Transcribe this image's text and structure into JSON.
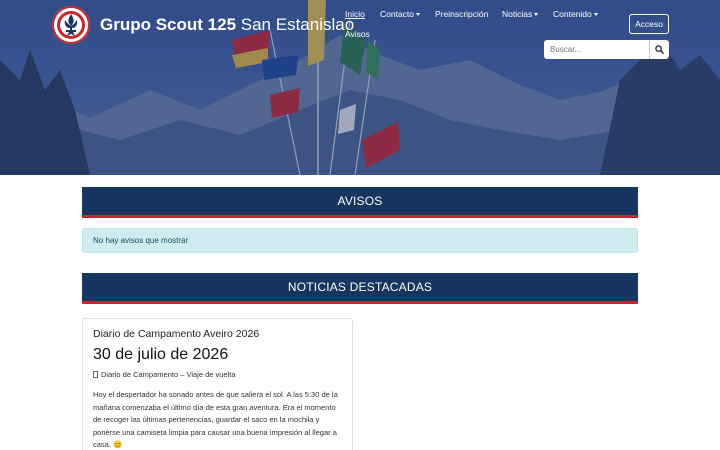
{
  "brand": {
    "bold": "Grupo Scout 125",
    "regular": " San Estanislao"
  },
  "nav": [
    {
      "label": "Inicio",
      "dropdown": false,
      "active": true
    },
    {
      "label": "Contacto",
      "dropdown": true,
      "active": false
    },
    {
      "label": "Preinscripción",
      "dropdown": false,
      "active": false
    },
    {
      "label": "Noticias",
      "dropdown": true,
      "active": false
    },
    {
      "label": "Contenido",
      "dropdown": true,
      "active": false
    },
    {
      "label": "Avisos",
      "dropdown": false,
      "active": false
    }
  ],
  "login": {
    "label": "Acceso"
  },
  "search": {
    "placeholder": "Buscar..."
  },
  "avisos": {
    "heading": "AVISOS",
    "empty_message": "No hay avisos que mostrar"
  },
  "destacadas": {
    "heading": "NOTICIAS DESTACADAS"
  },
  "article": {
    "title": "Diario de Campamento Aveiro 2026",
    "date": "30 de julio de 2026",
    "category": "Diario de Campamento – Viaje de vuelta",
    "body": "Hoy el despertador ha sonado antes de que saliera el sol. A las 5:30 de la mañana comenzaba el último día de esta gran aventura. Era el momento de recoger las últimas pertenencias, guardar el saco en la mochila y ponerse una camiseta limpia para causar una buena impresión al llegar a casa. 😊"
  },
  "colors": {
    "header_navy": "#163561",
    "accent_red": "#c9252b",
    "alert_bg": "#d1ecf1",
    "alert_text": "#0c5460"
  }
}
